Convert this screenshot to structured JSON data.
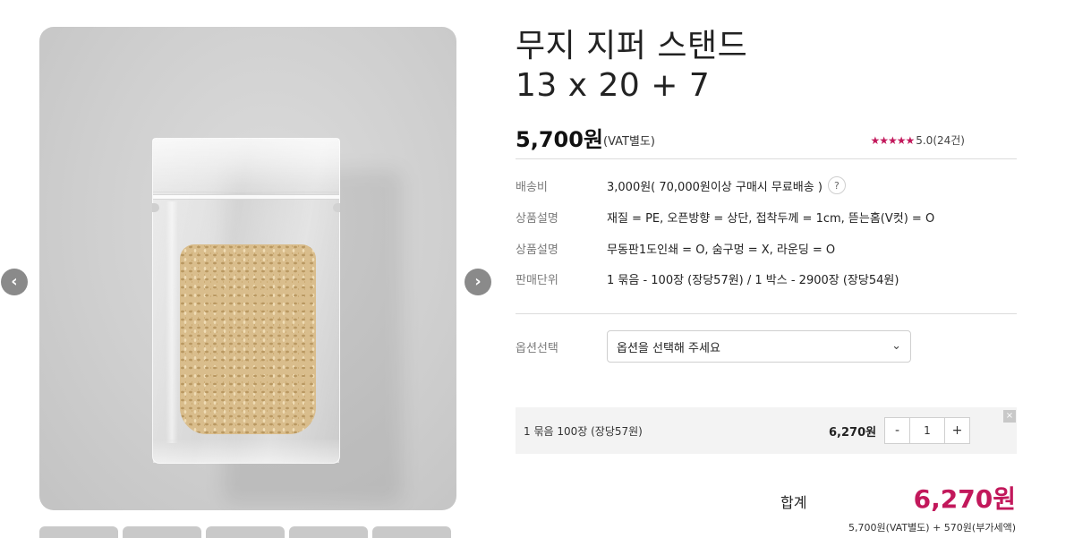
{
  "gallery": {
    "prev_icon": "chevron-left",
    "next_icon": "chevron-right",
    "prev_glyph": "‹",
    "next_glyph": "›",
    "thumbnail_count": 5
  },
  "product": {
    "title_line1": "무지 지퍼 스탠드",
    "title_line2": "13 x 20 + 7",
    "price": "5,700원",
    "price_vat": "(VAT별도)",
    "stars": "★★★★★",
    "rating": "5.0(24건)"
  },
  "info": [
    {
      "label": "배송비",
      "value": "3,000원( 70,000원이상 구매시 무료배송 )",
      "help": "?"
    },
    {
      "label": "상품설명",
      "value": "재질 = PE, 오픈방향 = 상단, 접착두께 = 1cm, 뜯는홈(V컷) = O"
    },
    {
      "label": "상품설명",
      "value": "무동판1도인쇄 = O, 숨구멍 = X, 라운딩 = O"
    },
    {
      "label": "판매단위",
      "value": "1 묶음 - 100장 (장당57원) / 1 박스 - 2900장 (장당54원)"
    }
  ],
  "option": {
    "label": "옵션선택",
    "selected": "옵션을 선택해 주세요",
    "chevron": "⌄"
  },
  "selected_item": {
    "label": "1 묶음 100장 (장당57원)",
    "price": "6,270원",
    "minus": "-",
    "quantity": "1",
    "plus": "+",
    "remove": "×"
  },
  "total": {
    "label": "합계",
    "price": "6,270원",
    "breakdown": "5,700원(VAT별도) + 570원(부가세액)"
  },
  "colors": {
    "accent": "#c2185b",
    "background": "#ffffff",
    "panel": "#f3f3f3"
  }
}
